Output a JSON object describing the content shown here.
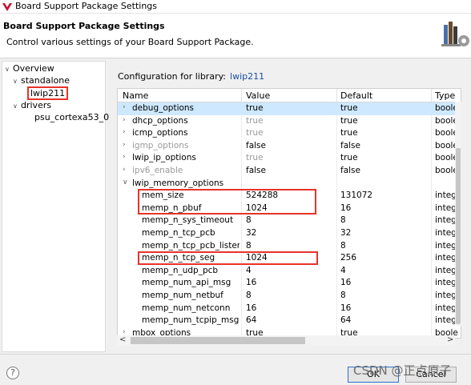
{
  "window": {
    "title": "Board Support Package Settings"
  },
  "header": {
    "title": "Board Support Package Settings",
    "description": "Control various settings of your Board Support Package."
  },
  "tree": {
    "overview": "Overview",
    "standalone": "standalone",
    "lwip": "lwip211",
    "drivers": "drivers",
    "cpu": "psu_cortexa53_0"
  },
  "config": {
    "label": "Configuration for library:",
    "library": "lwip211"
  },
  "table": {
    "columns": [
      "Name",
      "Value",
      "Default",
      "Type"
    ],
    "rows": [
      {
        "name": "debug_options",
        "value": "true",
        "default": "true",
        "type": "boole"
      },
      {
        "name": "dhcp_options",
        "value": "true",
        "default": "true",
        "type": "boole"
      },
      {
        "name": "icmp_options",
        "value": "true",
        "default": "true",
        "type": "boole"
      },
      {
        "name": "igmp_options",
        "value": "false",
        "default": "false",
        "type": "boole"
      },
      {
        "name": "lwip_ip_options",
        "value": "true",
        "default": "true",
        "type": "boole"
      },
      {
        "name": "ipv6_enable",
        "value": "false",
        "default": "false",
        "type": "boole"
      },
      {
        "name": "lwip_memory_options",
        "value": "",
        "default": "",
        "type": ""
      },
      {
        "name": "mem_size",
        "value": "524288",
        "default": "131072",
        "type": "integ"
      },
      {
        "name": "memp_n_pbuf",
        "value": "1024",
        "default": "16",
        "type": "integ"
      },
      {
        "name": "memp_n_sys_timeout",
        "value": "8",
        "default": "8",
        "type": "integ"
      },
      {
        "name": "memp_n_tcp_pcb",
        "value": "32",
        "default": "32",
        "type": "integ"
      },
      {
        "name": "memp_n_tcp_pcb_listen",
        "value": "8",
        "default": "8",
        "type": "integ"
      },
      {
        "name": "memp_n_tcp_seg",
        "value": "1024",
        "default": "256",
        "type": "integ"
      },
      {
        "name": "memp_n_udp_pcb",
        "value": "4",
        "default": "4",
        "type": "integ"
      },
      {
        "name": "memp_num_api_msg",
        "value": "16",
        "default": "16",
        "type": "integ"
      },
      {
        "name": "memp_num_netbuf",
        "value": "8",
        "default": "8",
        "type": "integ"
      },
      {
        "name": "memp_num_netconn",
        "value": "16",
        "default": "16",
        "type": "integ"
      },
      {
        "name": "memp_num_tcpip_msg",
        "value": "64",
        "default": "64",
        "type": "integ"
      },
      {
        "name": "mbox_options",
        "value": "true",
        "default": "true",
        "type": "boole"
      }
    ]
  },
  "buttons": {
    "ok": "OK",
    "cancel": "Cancel",
    "help": "?"
  },
  "watermark": "CSDN @正点原子",
  "colors": {
    "highlight_box": "#e8332b",
    "selected_row": "#cde8ff",
    "link": "#1a4fa3"
  }
}
